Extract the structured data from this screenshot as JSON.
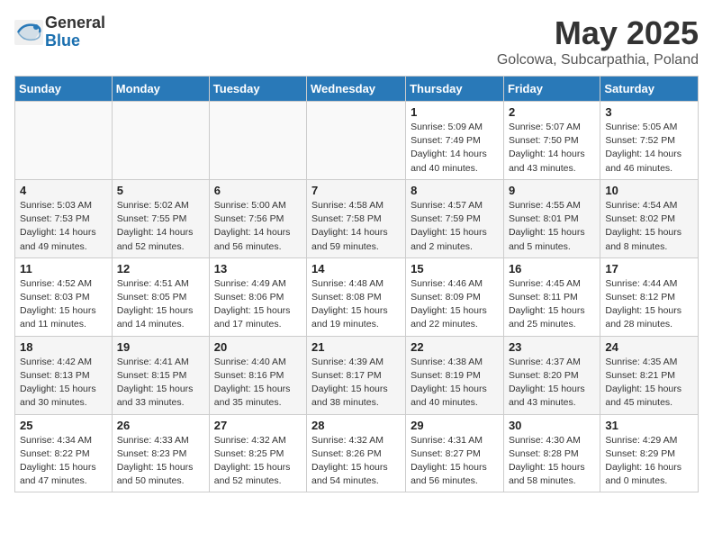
{
  "header": {
    "logo_general": "General",
    "logo_blue": "Blue",
    "month": "May 2025",
    "location": "Golcowa, Subcarpathia, Poland"
  },
  "weekdays": [
    "Sunday",
    "Monday",
    "Tuesday",
    "Wednesday",
    "Thursday",
    "Friday",
    "Saturday"
  ],
  "weeks": [
    [
      {
        "num": "",
        "info": ""
      },
      {
        "num": "",
        "info": ""
      },
      {
        "num": "",
        "info": ""
      },
      {
        "num": "",
        "info": ""
      },
      {
        "num": "1",
        "info": "Sunrise: 5:09 AM\nSunset: 7:49 PM\nDaylight: 14 hours\nand 40 minutes."
      },
      {
        "num": "2",
        "info": "Sunrise: 5:07 AM\nSunset: 7:50 PM\nDaylight: 14 hours\nand 43 minutes."
      },
      {
        "num": "3",
        "info": "Sunrise: 5:05 AM\nSunset: 7:52 PM\nDaylight: 14 hours\nand 46 minutes."
      }
    ],
    [
      {
        "num": "4",
        "info": "Sunrise: 5:03 AM\nSunset: 7:53 PM\nDaylight: 14 hours\nand 49 minutes."
      },
      {
        "num": "5",
        "info": "Sunrise: 5:02 AM\nSunset: 7:55 PM\nDaylight: 14 hours\nand 52 minutes."
      },
      {
        "num": "6",
        "info": "Sunrise: 5:00 AM\nSunset: 7:56 PM\nDaylight: 14 hours\nand 56 minutes."
      },
      {
        "num": "7",
        "info": "Sunrise: 4:58 AM\nSunset: 7:58 PM\nDaylight: 14 hours\nand 59 minutes."
      },
      {
        "num": "8",
        "info": "Sunrise: 4:57 AM\nSunset: 7:59 PM\nDaylight: 15 hours\nand 2 minutes."
      },
      {
        "num": "9",
        "info": "Sunrise: 4:55 AM\nSunset: 8:01 PM\nDaylight: 15 hours\nand 5 minutes."
      },
      {
        "num": "10",
        "info": "Sunrise: 4:54 AM\nSunset: 8:02 PM\nDaylight: 15 hours\nand 8 minutes."
      }
    ],
    [
      {
        "num": "11",
        "info": "Sunrise: 4:52 AM\nSunset: 8:03 PM\nDaylight: 15 hours\nand 11 minutes."
      },
      {
        "num": "12",
        "info": "Sunrise: 4:51 AM\nSunset: 8:05 PM\nDaylight: 15 hours\nand 14 minutes."
      },
      {
        "num": "13",
        "info": "Sunrise: 4:49 AM\nSunset: 8:06 PM\nDaylight: 15 hours\nand 17 minutes."
      },
      {
        "num": "14",
        "info": "Sunrise: 4:48 AM\nSunset: 8:08 PM\nDaylight: 15 hours\nand 19 minutes."
      },
      {
        "num": "15",
        "info": "Sunrise: 4:46 AM\nSunset: 8:09 PM\nDaylight: 15 hours\nand 22 minutes."
      },
      {
        "num": "16",
        "info": "Sunrise: 4:45 AM\nSunset: 8:11 PM\nDaylight: 15 hours\nand 25 minutes."
      },
      {
        "num": "17",
        "info": "Sunrise: 4:44 AM\nSunset: 8:12 PM\nDaylight: 15 hours\nand 28 minutes."
      }
    ],
    [
      {
        "num": "18",
        "info": "Sunrise: 4:42 AM\nSunset: 8:13 PM\nDaylight: 15 hours\nand 30 minutes."
      },
      {
        "num": "19",
        "info": "Sunrise: 4:41 AM\nSunset: 8:15 PM\nDaylight: 15 hours\nand 33 minutes."
      },
      {
        "num": "20",
        "info": "Sunrise: 4:40 AM\nSunset: 8:16 PM\nDaylight: 15 hours\nand 35 minutes."
      },
      {
        "num": "21",
        "info": "Sunrise: 4:39 AM\nSunset: 8:17 PM\nDaylight: 15 hours\nand 38 minutes."
      },
      {
        "num": "22",
        "info": "Sunrise: 4:38 AM\nSunset: 8:19 PM\nDaylight: 15 hours\nand 40 minutes."
      },
      {
        "num": "23",
        "info": "Sunrise: 4:37 AM\nSunset: 8:20 PM\nDaylight: 15 hours\nand 43 minutes."
      },
      {
        "num": "24",
        "info": "Sunrise: 4:35 AM\nSunset: 8:21 PM\nDaylight: 15 hours\nand 45 minutes."
      }
    ],
    [
      {
        "num": "25",
        "info": "Sunrise: 4:34 AM\nSunset: 8:22 PM\nDaylight: 15 hours\nand 47 minutes."
      },
      {
        "num": "26",
        "info": "Sunrise: 4:33 AM\nSunset: 8:23 PM\nDaylight: 15 hours\nand 50 minutes."
      },
      {
        "num": "27",
        "info": "Sunrise: 4:32 AM\nSunset: 8:25 PM\nDaylight: 15 hours\nand 52 minutes."
      },
      {
        "num": "28",
        "info": "Sunrise: 4:32 AM\nSunset: 8:26 PM\nDaylight: 15 hours\nand 54 minutes."
      },
      {
        "num": "29",
        "info": "Sunrise: 4:31 AM\nSunset: 8:27 PM\nDaylight: 15 hours\nand 56 minutes."
      },
      {
        "num": "30",
        "info": "Sunrise: 4:30 AM\nSunset: 8:28 PM\nDaylight: 15 hours\nand 58 minutes."
      },
      {
        "num": "31",
        "info": "Sunrise: 4:29 AM\nSunset: 8:29 PM\nDaylight: 16 hours\nand 0 minutes."
      }
    ]
  ]
}
